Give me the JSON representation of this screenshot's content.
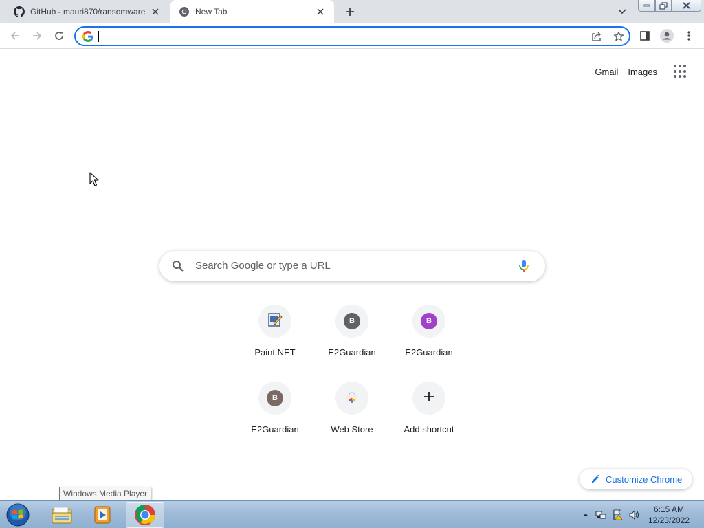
{
  "tabs": [
    {
      "title": "GitHub - mauri870/ransomware",
      "icon": "github-icon",
      "active": false
    },
    {
      "title": "New Tab",
      "icon": "chrome-icon",
      "active": true
    }
  ],
  "omnibox": {
    "value": "",
    "placeholder": ""
  },
  "top_links": {
    "gmail": "Gmail",
    "images": "Images"
  },
  "search": {
    "placeholder": "Search Google or type a URL"
  },
  "shortcuts": [
    {
      "label": "Paint.NET",
      "icon": "paintnet-icon"
    },
    {
      "label": "E2Guardian",
      "letter": "B",
      "color": "#5f6368"
    },
    {
      "label": "E2Guardian",
      "letter": "B",
      "color": "#a142c8"
    },
    {
      "label": "E2Guardian",
      "letter": "B",
      "color": "#7b6a64"
    },
    {
      "label": "Web Store",
      "icon": "webstore-icon"
    },
    {
      "label": "Add shortcut",
      "icon": "plus-icon"
    }
  ],
  "customize": {
    "label": "Customize Chrome"
  },
  "tooltip": {
    "text": "Windows Media Player"
  },
  "taskbar": {
    "items": [
      "windows-explorer-icon",
      "windows-media-player-icon",
      "chrome-icon"
    ],
    "clock_time": "6:15 AM",
    "clock_date": "12/23/2022"
  },
  "colors": {
    "accent": "#1a73e8",
    "tabstrip": "#dee1e6",
    "taskbar": "#9fbbd8"
  }
}
